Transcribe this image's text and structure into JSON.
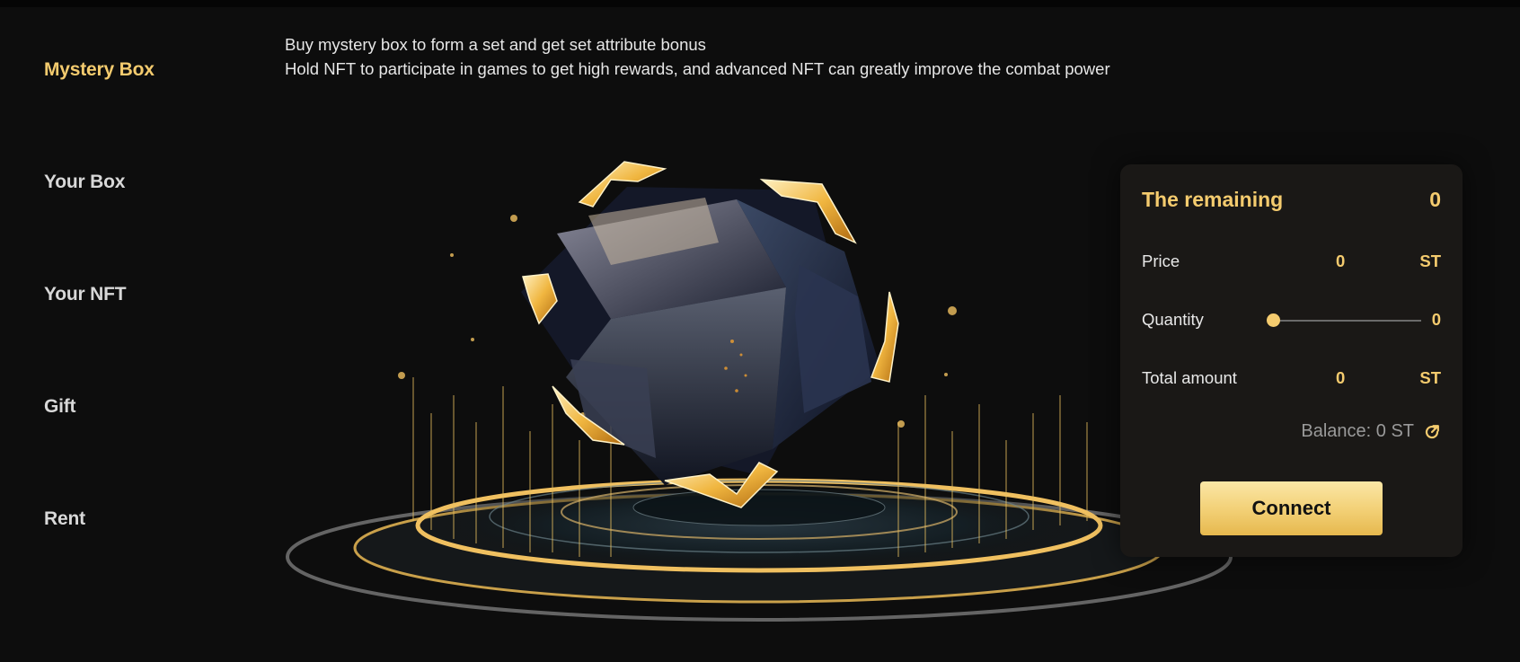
{
  "sidebar": {
    "items": [
      {
        "label": "Mystery Box",
        "active": true
      },
      {
        "label": "Your Box",
        "active": false
      },
      {
        "label": "Your NFT",
        "active": false
      },
      {
        "label": "Gift",
        "active": false
      },
      {
        "label": "Rent",
        "active": false
      }
    ]
  },
  "intro": {
    "line1": "Buy mystery box to form a set and get set attribute bonus",
    "line2": "Hold NFT to participate in games to get high rewards, and advanced NFT can greatly improve the combat power"
  },
  "panel": {
    "remaining_label": "The remaining",
    "remaining_value": "0",
    "price_label": "Price",
    "price_value": "0",
    "price_unit": "ST",
    "quantity_label": "Quantity",
    "quantity_value": "0",
    "total_label": "Total amount",
    "total_value": "0",
    "total_unit": "ST",
    "balance_text": "Balance: 0 ST",
    "connect_label": "Connect"
  },
  "icons": {
    "refresh": "refresh-icon",
    "mystery_box": "mystery-box-cube-illustration"
  },
  "colors": {
    "accent": "#f4cb6e",
    "background": "#0d0d0d",
    "panel": "#1a1816"
  }
}
